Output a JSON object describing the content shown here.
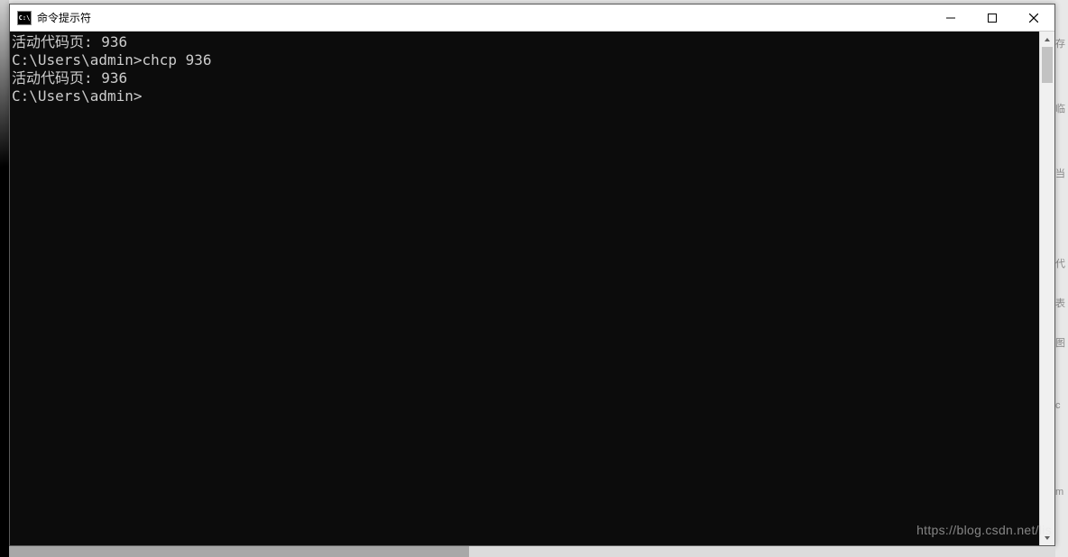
{
  "window": {
    "title": "命令提示符",
    "icon_label": "C:\\"
  },
  "console": {
    "lines": [
      "活动代码页: 936",
      "",
      "C:\\Users\\admin>chcp 936",
      "活动代码页: 936",
      "",
      "C:\\Users\\admin>"
    ]
  },
  "watermark": "https://blog.csdn.net/lis",
  "bg_right_hints": [
    "存",
    "",
    "临",
    "",
    "当",
    "",
    "",
    "代",
    "表",
    "图",
    "",
    "c",
    "",
    "",
    "m"
  ]
}
